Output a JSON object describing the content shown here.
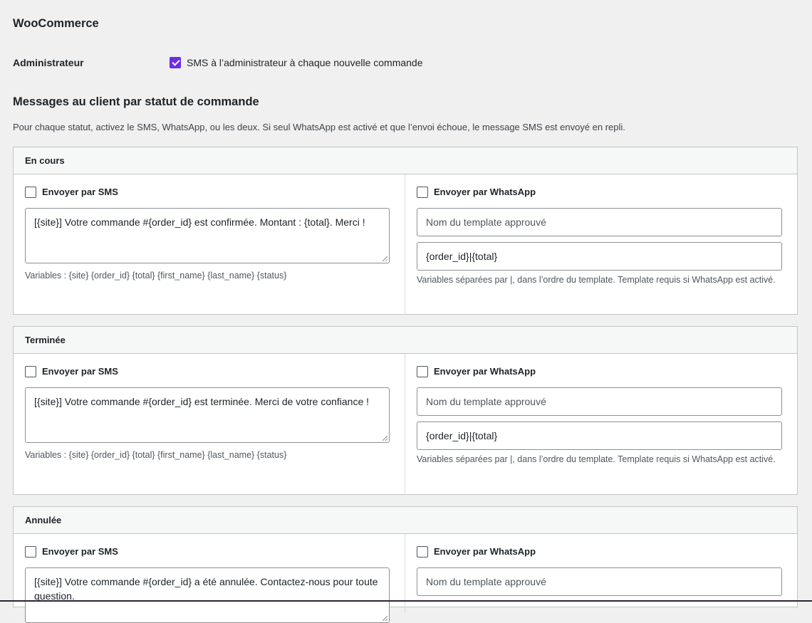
{
  "woocommerce": {
    "title": "WooCommerce",
    "admin_label": "Administrateur",
    "admin_checkbox_label": "SMS à l’administrateur à chaque nouvelle commande",
    "admin_checked": true
  },
  "client_messages": {
    "title": "Messages au client par statut de commande",
    "description": "Pour chaque statut, activez le SMS, WhatsApp, ou les deux. Si seul WhatsApp est activé et que l’envoi échoue, le message SMS est envoyé en repli."
  },
  "statuses": [
    {
      "name": "En cours",
      "sms_label": "Envoyer par SMS",
      "sms_checked": false,
      "sms_message": "[{site}] Votre commande #{order_id} est confirmée. Montant : {total}. Merci !",
      "sms_hint": "Variables : {site} {order_id} {total} {first_name} {last_name} {status}",
      "wa_label": "Envoyer par WhatsApp",
      "wa_checked": false,
      "wa_template_placeholder": "Nom du template approuvé",
      "wa_vars_value": "{order_id}|{total}",
      "wa_hint": "Variables séparées par |, dans l’ordre du template. Template requis si WhatsApp est activé."
    },
    {
      "name": "Terminée",
      "sms_label": "Envoyer par SMS",
      "sms_checked": false,
      "sms_message": "[{site}] Votre commande #{order_id} est terminée. Merci de votre confiance !",
      "sms_hint": "Variables : {site} {order_id} {total} {first_name} {last_name} {status}",
      "wa_label": "Envoyer par WhatsApp",
      "wa_checked": false,
      "wa_template_placeholder": "Nom du template approuvé",
      "wa_vars_value": "{order_id}|{total}",
      "wa_hint": "Variables séparées par |, dans l’ordre du template. Template requis si WhatsApp est activé."
    },
    {
      "name": "Annulée",
      "sms_label": "Envoyer par SMS",
      "sms_checked": false,
      "sms_message": "[{site}] Votre commande #{order_id} a été annulée. Contactez-nous pour toute question.",
      "wa_label": "Envoyer par WhatsApp",
      "wa_checked": false,
      "wa_template_placeholder": "Nom du template approuvé"
    }
  ],
  "colors": {
    "accent": "#6b2ee6",
    "background": "#f0f0f1",
    "border": "#c3c4c7"
  }
}
